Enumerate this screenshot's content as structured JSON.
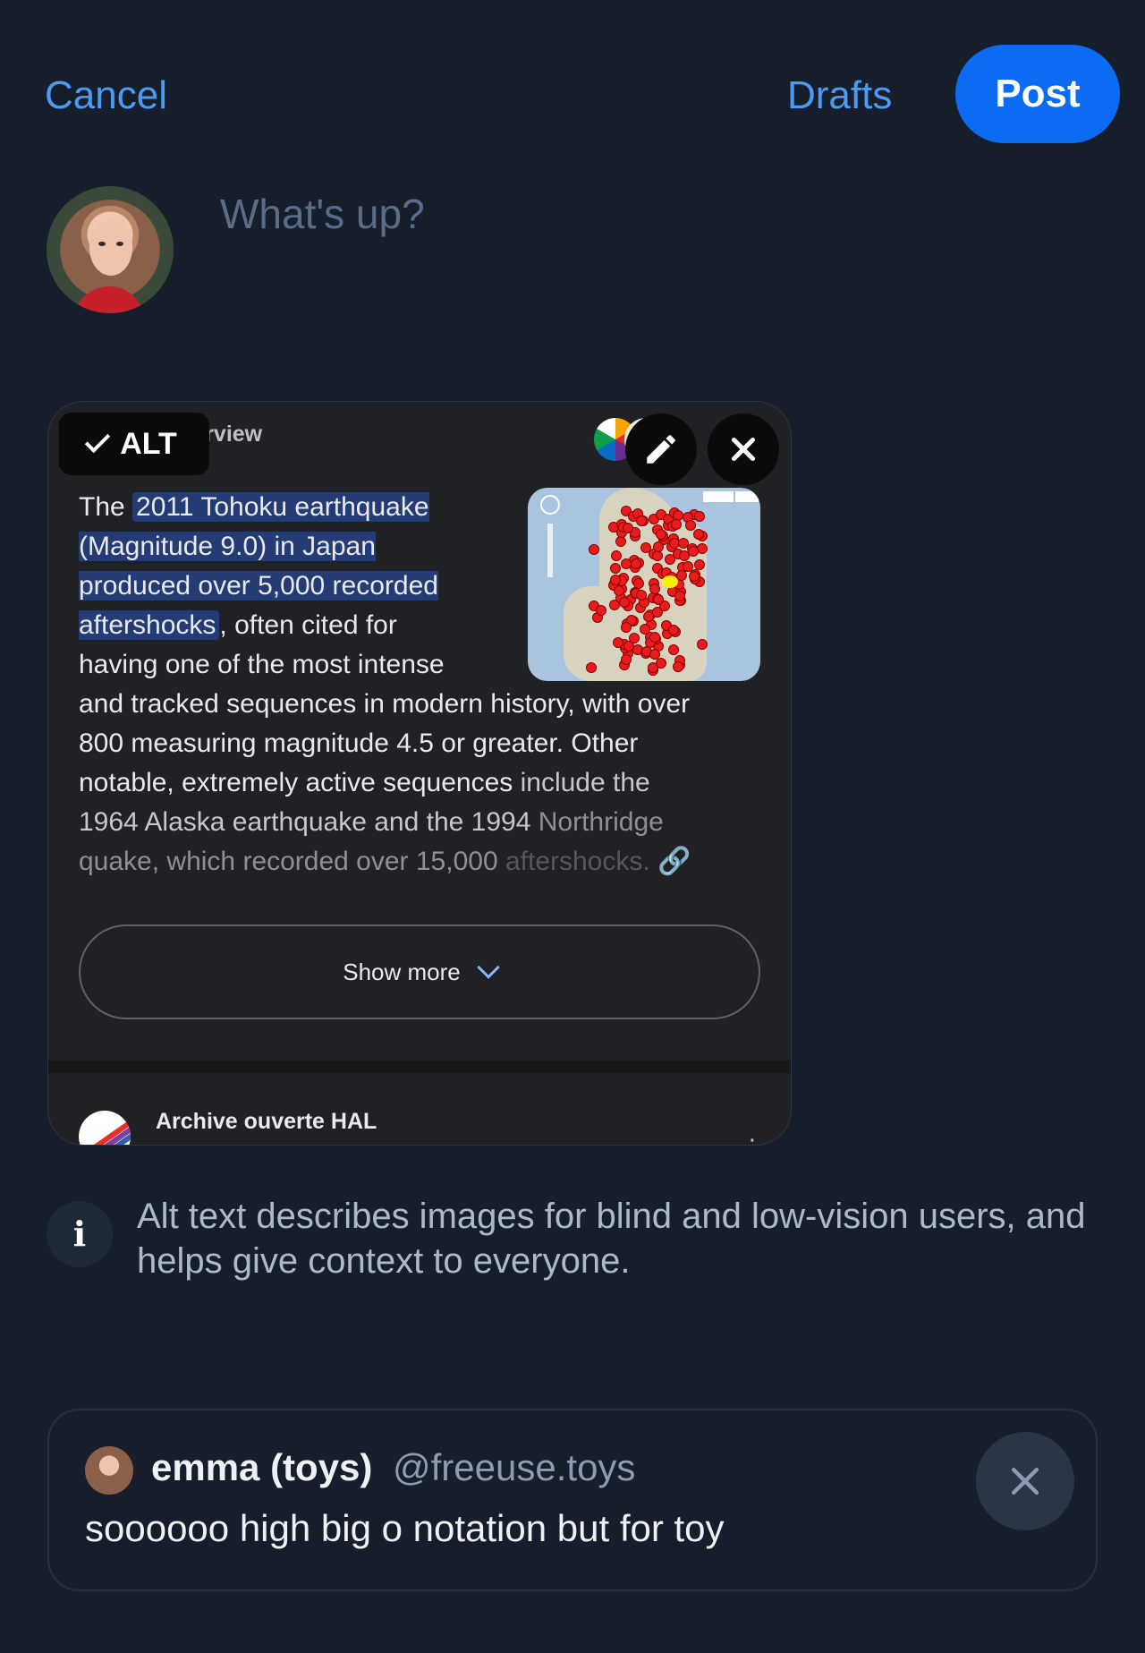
{
  "header": {
    "cancel_label": "Cancel",
    "drafts_label": "Drafts",
    "post_label": "Post"
  },
  "composer": {
    "placeholder": "What's up?"
  },
  "image_card": {
    "alt_badge": "ALT",
    "ai_overview_title": "AI Overview",
    "paragraph": {
      "lead": "The ",
      "highlight_1": "2011 Tohoku earthquake (Magnitude 9.0) in Japan produced over 5,000 recorded aftershocks",
      "rest_1": ", often cited for having one of the most intense and tracked sequences in modern history, with over 800 measuring magnitude 4.5 or greater. Other notable, extremely active sequences ",
      "rest_2": "include the 1964 Alaska earthquake and the 1994 ",
      "rest_3": "Northridge quake, which recorded over 15,000 ",
      "rest_4": "aftershocks."
    },
    "show_more_label": "Show more",
    "source_title": "Archive ouverte HAL"
  },
  "info": {
    "text": "Alt text describes images for blind and low-vision users, and helps give context to everyone."
  },
  "quote": {
    "display_name": "emma (toys)",
    "handle": "@freeuse.toys",
    "text": "soooooo high big o notation but for toy"
  },
  "colors": {
    "background": "#161e2b",
    "accent": "#0b6cf3",
    "link": "#4d9bf0"
  }
}
